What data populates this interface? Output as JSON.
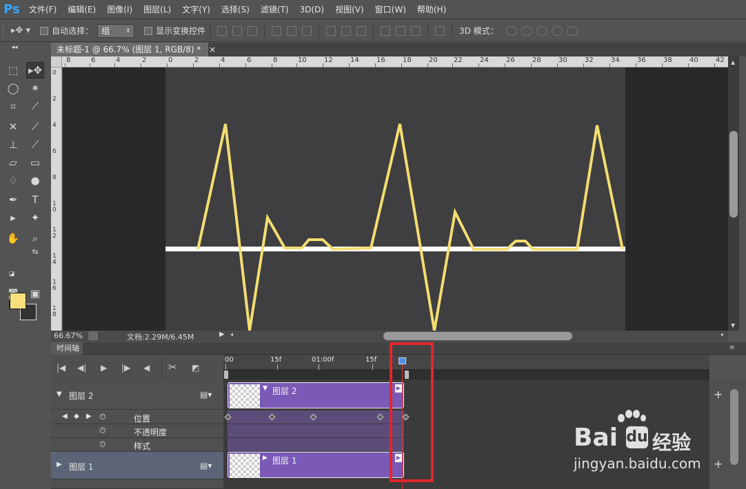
{
  "menubar": {
    "logo": "Ps",
    "items": [
      "文件(F)",
      "编辑(E)",
      "图像(I)",
      "图层(L)",
      "文字(Y)",
      "选择(S)",
      "滤镜(T)",
      "3D(D)",
      "视图(V)",
      "窗口(W)",
      "帮助(H)"
    ]
  },
  "options": {
    "auto_select_label": "自动选择：",
    "auto_select_value": "组",
    "show_transform_label": "显示变换控件",
    "mode3d_label": "3D 模式："
  },
  "document": {
    "tab_title": "未标题-1 @ 66.7% (图层 1, RGB/8) *",
    "ruler_top": [
      "8",
      "6",
      "4",
      "2",
      "0",
      "2",
      "4",
      "6",
      "8",
      "10",
      "12",
      "14",
      "16",
      "18",
      "20",
      "22",
      "24",
      "26",
      "28",
      "30",
      "32",
      "34",
      "36",
      "38",
      "40",
      "42"
    ],
    "ruler_left": [
      "0",
      "2",
      "4",
      "6",
      "8",
      "1\n0",
      "1\n2",
      "1\n4",
      "1\n6",
      "1\n8"
    ],
    "zoom": "66.67%",
    "doc_size": "文档:2.29M/6.45M"
  },
  "timeline": {
    "tab": "时间轴",
    "ruler": [
      "00",
      "15f",
      "01:00f",
      "15f"
    ],
    "layer2": {
      "name": "图层 2",
      "clip_name": "图层 2"
    },
    "props": [
      "位置",
      "不透明度",
      "样式"
    ],
    "layer1": {
      "name": "图层 1",
      "clip_name": "图层 1"
    },
    "add_symbol": "+"
  },
  "watermark": {
    "brand": "Bai",
    "brand2": "经验",
    "url": "jingyan.baidu.com"
  },
  "colors": {
    "foreground": "#f9e07d",
    "line": "#f2dd72",
    "clip": "#7b5ab7",
    "highlight": "#e0262b"
  }
}
